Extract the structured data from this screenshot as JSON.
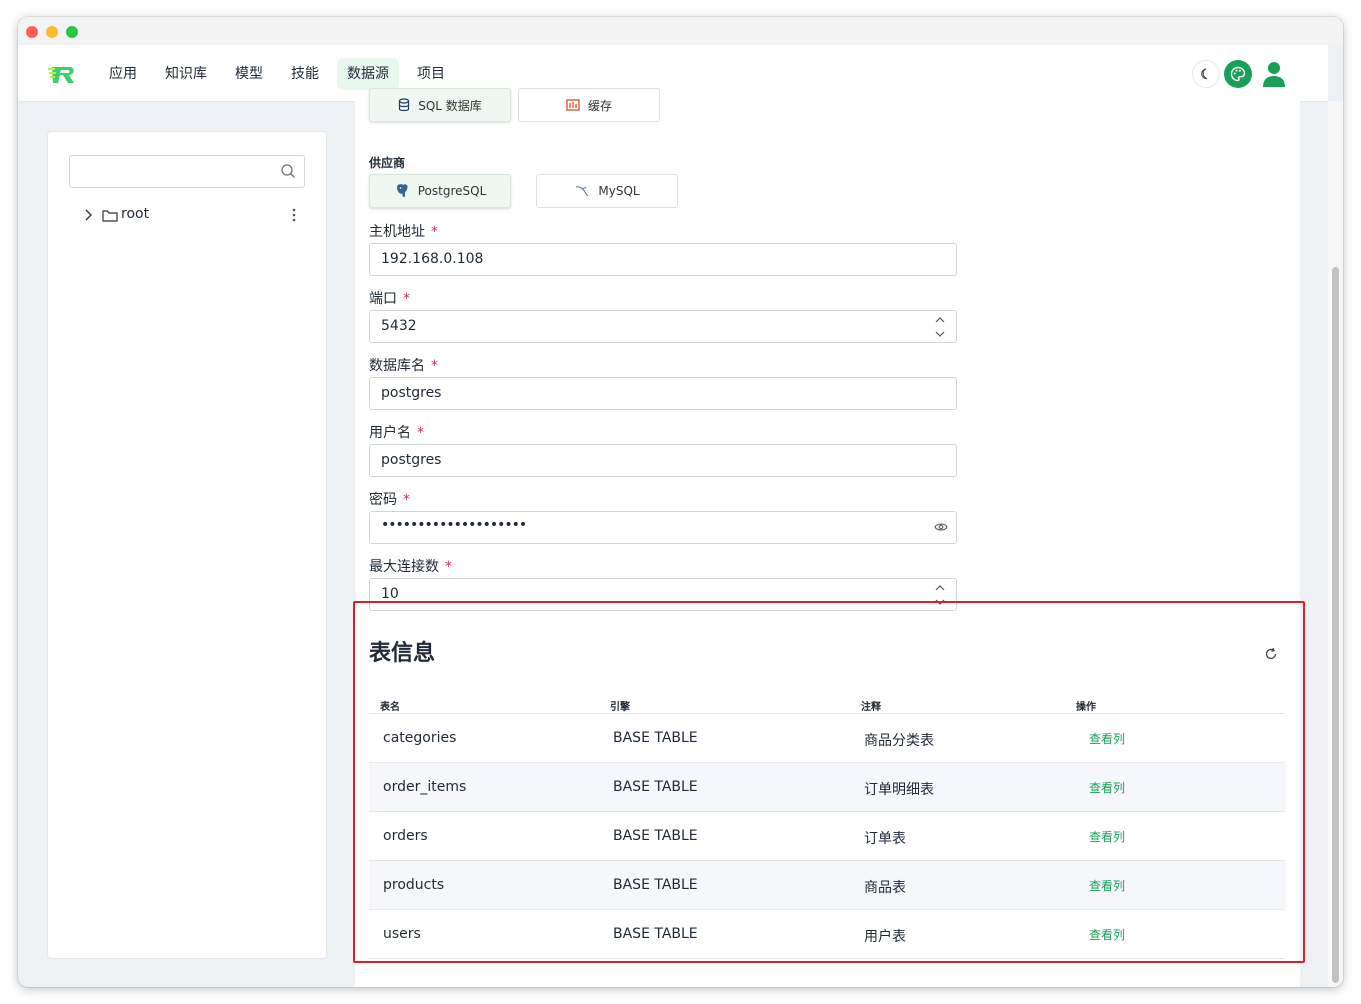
{
  "nav": {
    "items": [
      "应用",
      "知识库",
      "模型",
      "技能",
      "数据源",
      "项目"
    ],
    "active_index": 4
  },
  "sidebar": {
    "search_placeholder": "",
    "tree": [
      {
        "label": "root"
      }
    ]
  },
  "form": {
    "type_options": [
      {
        "label": "SQL 数据库",
        "selected": true
      },
      {
        "label": "缓存",
        "selected": false
      }
    ],
    "provider_label": "供应商",
    "providers": [
      {
        "label": "PostgreSQL",
        "selected": true
      },
      {
        "label": "MySQL",
        "selected": false
      }
    ],
    "host": {
      "label": "主机地址",
      "value": "192.168.0.108"
    },
    "port": {
      "label": "端口",
      "value": "5432"
    },
    "database": {
      "label": "数据库名",
      "value": "postgres"
    },
    "username": {
      "label": "用户名",
      "value": "postgres"
    },
    "password": {
      "label": "密码",
      "value": "••••••••••••••••••••"
    },
    "max_connections": {
      "label": "最大连接数",
      "value": "10"
    },
    "required_mark": "*"
  },
  "table_info": {
    "title": "表信息",
    "headers": [
      "表名",
      "引擎",
      "注释",
      "操作"
    ],
    "rows": [
      {
        "name": "categories",
        "engine": "BASE TABLE",
        "comment": "商品分类表",
        "action": "查看列"
      },
      {
        "name": "order_items",
        "engine": "BASE TABLE",
        "comment": "订单明细表",
        "action": "查看列"
      },
      {
        "name": "orders",
        "engine": "BASE TABLE",
        "comment": "订单表",
        "action": "查看列"
      },
      {
        "name": "products",
        "engine": "BASE TABLE",
        "comment": "商品表",
        "action": "查看列"
      },
      {
        "name": "users",
        "engine": "BASE TABLE",
        "comment": "用户表",
        "action": "查看列"
      }
    ]
  },
  "colors": {
    "accent": "#18a058",
    "highlight": "#e11d2a",
    "required": "#d03050"
  }
}
